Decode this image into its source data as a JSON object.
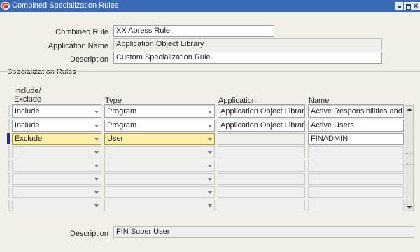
{
  "window": {
    "title": "Combined Specialization Rules",
    "icon": "oracle-app-icon",
    "controls": [
      "minimize-icon",
      "maximize-icon",
      "close-icon"
    ]
  },
  "header": {
    "combined_rule_label": "Combined Rule",
    "combined_rule_value": "XX Apress Rule",
    "application_name_label": "Application Name",
    "application_name_value": "Application Object Library",
    "description_label": "Description",
    "description_value": "Custom Specialization Rule"
  },
  "rules": {
    "section_title": "Specialization Rules",
    "columns": {
      "include_exclude_line1": "Include/",
      "include_exclude_line2": "Exclude",
      "type": "Type",
      "application": "Application",
      "name": "Name"
    },
    "rows": [
      {
        "include": "Include",
        "type": "Program",
        "application": "Application Object Library",
        "name": "Active Responsibilities and U"
      },
      {
        "include": "Include",
        "type": "Program",
        "application": "Application Object Library",
        "name": "Active Users"
      },
      {
        "include": "Exclude",
        "type": "User",
        "application": "",
        "name": "FINADMIN"
      }
    ]
  },
  "footer": {
    "description_label": "Description",
    "description_value": "FIN Super User"
  },
  "colors": {
    "titlebar": "#3a69b6",
    "background": "#f0f0e8",
    "current_record_marker": "#2c2a8a",
    "current_field": "#fdf1a9"
  }
}
